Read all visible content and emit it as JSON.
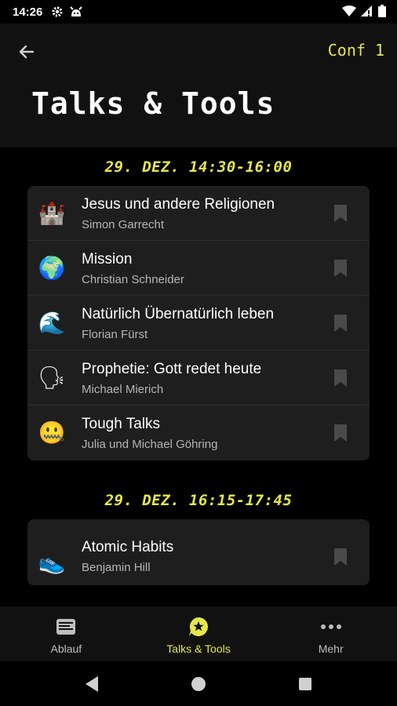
{
  "status_bar": {
    "time": "14:26"
  },
  "header": {
    "conference_label": "Conf 1",
    "title": "Talks & Tools"
  },
  "sections": [
    {
      "time": "29. DEZ. 14:30-16:00",
      "talks": [
        {
          "emoji": "🏰",
          "emoji_name": "castle-icon",
          "title": "Jesus und andere Religionen",
          "speaker": "Simon Garrecht"
        },
        {
          "emoji": "🌍",
          "emoji_name": "globe-icon",
          "title": "Mission",
          "speaker": "Christian Schneider"
        },
        {
          "emoji": "🌊",
          "emoji_name": "wave-icon",
          "title": "Natürlich Übernatürlich leben",
          "speaker": "Florian Fürst"
        },
        {
          "emoji": "🗣",
          "emoji_name": "speaking-head-icon",
          "title": "Prophetie: Gott redet heute",
          "speaker": "Michael Mierich"
        },
        {
          "emoji": "🤐",
          "emoji_name": "zipper-mouth-icon",
          "title": "Tough Talks",
          "speaker": "Julia und Michael Göhring"
        }
      ]
    },
    {
      "time": "29. DEZ. 16:15-17:45",
      "talks": [
        {
          "emoji": "👟",
          "emoji_name": "sneaker-icon",
          "title": "Atomic Habits",
          "speaker": "Benjamin Hill"
        }
      ]
    }
  ],
  "bottom_nav": [
    {
      "label": "Ablauf",
      "icon": "schedule-icon",
      "active": false
    },
    {
      "label": "Talks & Tools",
      "icon": "chat-star-icon",
      "active": true
    },
    {
      "label": "Mehr",
      "icon": "more-dots-icon",
      "active": false
    }
  ],
  "colors": {
    "accent": "#e6e84a",
    "background": "#000000",
    "card": "#1e1e1e",
    "header": "#111111"
  }
}
